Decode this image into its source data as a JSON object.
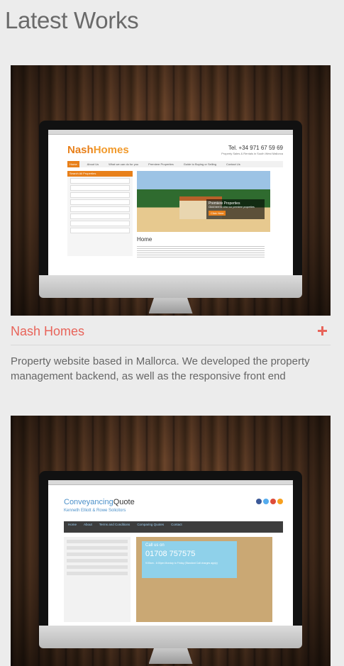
{
  "section": {
    "title": "Latest Works"
  },
  "works": [
    {
      "title": "Nash Homes",
      "description": "Property website based in Mallorca. We developed the property management backend, as well as the responsive front end",
      "mock": {
        "logo_a": "Nash",
        "logo_b": "Homes",
        "phone": "Tel. +34 971 67 59 69",
        "tagline": "Property Sales & Rentals in South West Mallorca",
        "nav": [
          "Home",
          "About Us",
          "What we can do for you",
          "Premiere Properties",
          "Guide to Buying or Selling",
          "Contact Us"
        ],
        "side_heading": "Search All Properties",
        "caption_title": "Premiere Properties",
        "caption_text": "Click here to view our premiere properties",
        "caption_button": "Click Here",
        "home_heading": "Home"
      }
    },
    {
      "title": "",
      "description": "",
      "mock": {
        "logo_a": "Conveyancing",
        "logo_b": "Quote",
        "subtitle": "Kenneth Elliott & Rowe Solicitors",
        "nav": [
          "Home",
          "About",
          "Terms and Conditions",
          "Comparing Quotes",
          "Contact"
        ],
        "call_label": "Call us on",
        "call_number": "01708 757575",
        "call_hours": "9:00am - 6:00pm Monday to Friday (Standard Call charges apply)"
      }
    }
  ],
  "colors": {
    "accent": "#e8645a",
    "orange": "#e8801a",
    "blue": "#4a8fc8"
  }
}
